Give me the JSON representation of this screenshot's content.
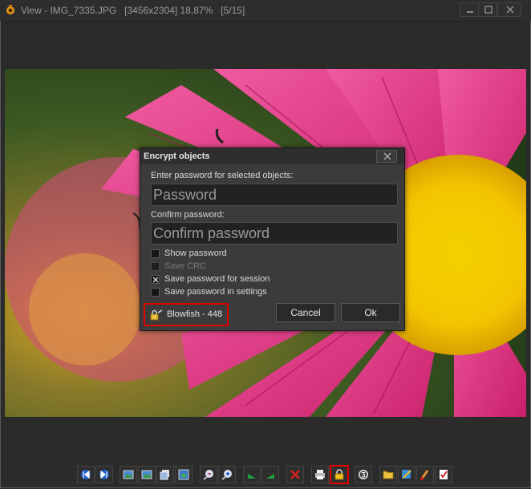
{
  "window": {
    "title": "View - IMG_7335.JPG   [3456x2304] 18,87%   [5/15]"
  },
  "dialog": {
    "title": "Encrypt objects",
    "password_label": "Enter password for selected objects:",
    "password_placeholder": "Password",
    "password_value": "",
    "confirm_label": "Confirm password:",
    "confirm_placeholder": "Confirm password",
    "confirm_value": "",
    "options": [
      {
        "label": "Show password",
        "checked": false,
        "enabled": true
      },
      {
        "label": "Save CRC",
        "checked": false,
        "enabled": false
      },
      {
        "label": "Save password for session",
        "checked": true,
        "enabled": true
      },
      {
        "label": "Save password in settings",
        "checked": false,
        "enabled": true
      }
    ],
    "cipher_label": "Blowfish - 448",
    "cancel_label": "Cancel",
    "ok_label": "Ok"
  },
  "toolbar": {
    "icons": [
      "first-image-icon",
      "last-image-icon",
      "image-icon",
      "image-icon",
      "copy-image-icon",
      "image-export-icon",
      "zoom-out-icon",
      "zoom-in-icon",
      "rotate-left-icon",
      "rotate-right-icon",
      "delete-icon",
      "print-icon",
      "lock-icon",
      "number-3-icon",
      "folder-open-icon",
      "image-edit-icon",
      "paint-brush-icon",
      "checklist-icon"
    ]
  },
  "colors": {
    "highlight": "#e00000",
    "petal": "#e0337f",
    "flower_center": "#f2c400",
    "background_leaf": "#4a6b2a"
  }
}
